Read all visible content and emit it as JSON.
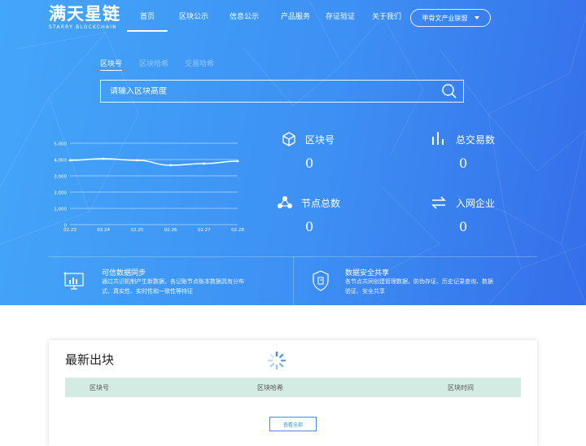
{
  "header": {
    "logo_name": "满天星链",
    "logo_sub": "STARRY BLOCKCHAIN",
    "nav": [
      "首页",
      "区块公示",
      "信息公示",
      "产品服务",
      "存证验证",
      "关于我们"
    ],
    "active_nav_index": 0,
    "alliance_label": "甲骨文产业联盟"
  },
  "search": {
    "tabs": [
      "区块号",
      "区块哈希",
      "交易哈希"
    ],
    "active_tab_index": 0,
    "placeholder": "请输入区块高度"
  },
  "chart_data": {
    "type": "line",
    "categories": [
      "02.23",
      "02.24",
      "02.25",
      "02.26",
      "02.27",
      "02.28"
    ],
    "values": [
      3950,
      4050,
      3950,
      3650,
      3750,
      3900
    ],
    "title": "",
    "xlabel": "",
    "ylabel": "",
    "ylim": [
      0,
      5000
    ],
    "yticks": [
      "5,000",
      "4,000",
      "3,000",
      "2,000",
      "1,000",
      "0"
    ],
    "grid": true,
    "colors": {
      "line": "#ffffff",
      "grid": "#ffffff"
    }
  },
  "stats": [
    {
      "icon": "cube-icon",
      "label": "区块号",
      "value": "0"
    },
    {
      "icon": "bar-chart-icon",
      "label": "总交易数",
      "value": "0"
    },
    {
      "icon": "nodes-icon",
      "label": "节点总数",
      "value": "0"
    },
    {
      "icon": "exchange-icon",
      "label": "入网企业",
      "value": "0"
    }
  ],
  "features": [
    {
      "icon": "monitor-chart-icon",
      "title": "可信数据同步",
      "desc_line1": "通过共识机制产生新数据，各记账节点账本数据具有分布",
      "desc_line2": "式、真实性、实时性和一致性等特征"
    },
    {
      "icon": "shield-data-icon",
      "title": "数据安全共享",
      "desc_line1": "各节点共同创建管理数据，防伪存证、历史记录查询、数据",
      "desc_line2": "验证、安全共享"
    }
  ],
  "latest": {
    "title": "最新出块",
    "columns": [
      "区块号",
      "区块哈希",
      "区块时间"
    ],
    "view_all": "查看全部"
  },
  "colors": {
    "hero_start": "#44a6f8",
    "hero_end": "#356ee9",
    "table_header_bg": "#d3ebe2",
    "link_blue": "#3a8ee6"
  }
}
